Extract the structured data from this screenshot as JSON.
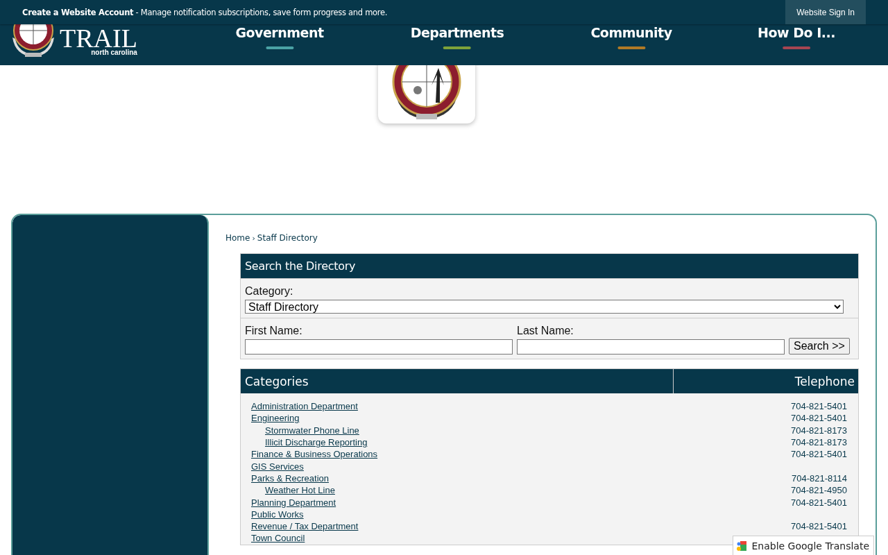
{
  "top_bar": {
    "account_text": "Create a Website Account",
    "account_note": " - Manage notification subscriptions, save form progress and more.",
    "sign_in": "Website Sign In"
  },
  "logo": {
    "line_2": "TRAIL",
    "line_3": "north carolina"
  },
  "nav": [
    {
      "label": "Government",
      "color": "#4aa3a5"
    },
    {
      "label": "Departments",
      "color": "#7ea33a"
    },
    {
      "label": "Community",
      "color": "#b07a26"
    },
    {
      "label": "How Do I...",
      "color": "#a64552"
    }
  ],
  "breadcrumb": [
    {
      "label": "Home"
    },
    {
      "label": "Staff Directory"
    }
  ],
  "breadcrumb_separator": "›",
  "search_form": {
    "title": "Search the Directory",
    "category_label": "Category:",
    "category_value": "Staff Directory",
    "first_name_label": "First Name:",
    "last_name_label": "Last Name:",
    "button": "Search >>"
  },
  "table": {
    "columns": [
      "Categories",
      "Telephone"
    ],
    "rows": [
      {
        "name": "Administration Department",
        "phone": "704-821-5401"
      },
      {
        "name": "Engineering",
        "phone": "704-821-5401",
        "children": [
          {
            "name": "Stormwater Phone Line",
            "phone": "704-821-8173"
          },
          {
            "name": "Illicit Discharge Reporting",
            "phone": "704-821-8173"
          }
        ]
      },
      {
        "name": "Finance & Business Operations",
        "phone": "704-821-5401"
      },
      {
        "name": "GIS Services"
      },
      {
        "name": "Parks & Recreation",
        "phone": "704-821-8114",
        "children": [
          {
            "name": "Weather Hot Line",
            "phone": "704-821-4950"
          }
        ]
      },
      {
        "name": "Planning Department",
        "phone": "704-821-5401"
      },
      {
        "name": "Public Works"
      },
      {
        "name": "Revenue / Tax Department",
        "phone": "704-821-5401"
      },
      {
        "name": "Town Council"
      }
    ]
  },
  "translate_button": "Enable Google Translate"
}
